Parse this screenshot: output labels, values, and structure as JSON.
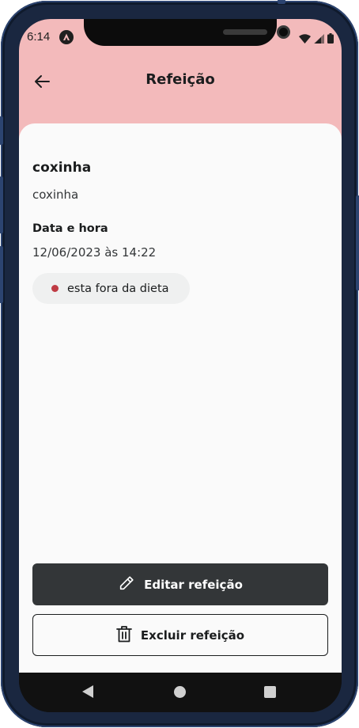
{
  "status_bar": {
    "time": "6:14"
  },
  "header": {
    "title": "Refeição",
    "background_color": "#f3babb"
  },
  "meal": {
    "name": "coxinha",
    "description": "coxinha",
    "datetime_label": "Data e hora",
    "datetime_value": "12/06/2023 às 14:22",
    "diet_status": {
      "label": "esta fora da dieta",
      "dot_color": "#bf3b44"
    }
  },
  "actions": {
    "edit_label": "Editar refeição",
    "delete_label": "Excluir refeição"
  },
  "icons": {
    "back": "arrow-left-icon",
    "edit": "pencil-icon",
    "delete": "trash-icon",
    "status_app": "app-notification-icon",
    "wifi": "wifi-icon",
    "signal": "signal-icon",
    "battery": "battery-icon"
  }
}
